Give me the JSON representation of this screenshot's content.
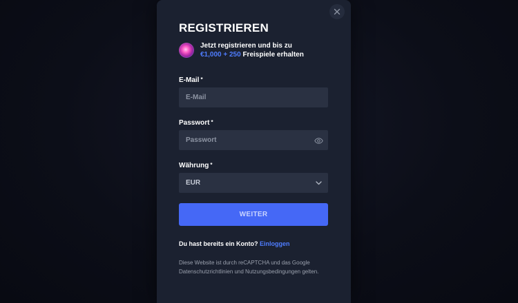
{
  "modal": {
    "title": "REGISTRIEREN",
    "promo": {
      "line1": "Jetzt registrieren und bis zu",
      "amount": "€1,000 + 250",
      "line2_rest": " Freispiele erhalten",
      "icon": "spiral-logo-icon"
    },
    "close_icon": "close-icon"
  },
  "form": {
    "email": {
      "label": "E-Mail",
      "required_mark": "*",
      "placeholder": "E-Mail",
      "value": ""
    },
    "password": {
      "label": "Passwort",
      "required_mark": "*",
      "placeholder": "Passwort",
      "value": "",
      "toggle_icon": "eye-icon"
    },
    "currency": {
      "label": "Währung",
      "required_mark": "*",
      "selected": "EUR",
      "dropdown_icon": "chevron-down-icon"
    },
    "submit_label": "WEITER"
  },
  "footer": {
    "login_prompt": "Du hast bereits ein Konto?",
    "login_link": "Einloggen",
    "legal": "Diese Website ist durch reCAPTCHA und das Google Datenschutzrichtlinien und Nutzungsbedingungen gelten."
  },
  "colors": {
    "modal_bg": "#1b2130",
    "input_bg": "#2a3142",
    "accent": "#4568f6",
    "link": "#4f7dff"
  }
}
